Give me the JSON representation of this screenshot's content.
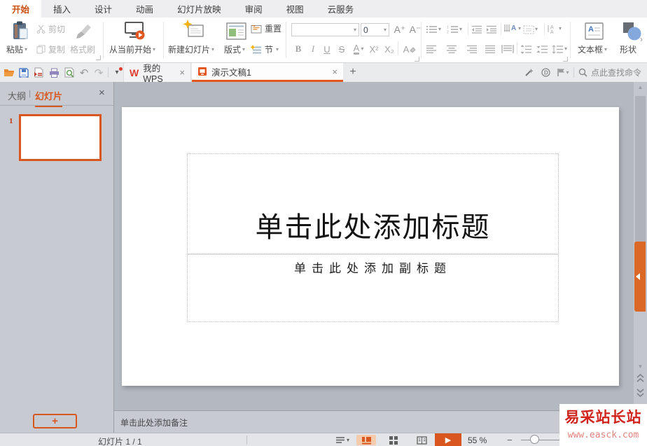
{
  "colors": {
    "accent": "#d9571e",
    "menu_active_text": "#c9500f",
    "watermark_red": "#d0241c",
    "highlight_bg": "#f5cbae"
  },
  "icons": {
    "dropdown_caret": "▾",
    "close": "×",
    "add_tab": "+",
    "chevron_more": "›",
    "play": "▶",
    "minus": "−",
    "undo": "↶",
    "redo": "↷",
    "up_arrow": "▲",
    "down_arrow": "▼",
    "paste-icon": "clipboard",
    "cut-icon": "scissors",
    "copy-icon": "two-pages",
    "format-painter-icon": "brush",
    "play-from-current-icon": "screen-with-play",
    "new-slide-icon": "slide-with-sparkle",
    "layout-icon": "slide-layout",
    "reset-icon": "slide-refresh",
    "section-icon": "rows-with-sparkle",
    "textbox-icon": "box-with-A",
    "shapes-icon": "square-and-circle",
    "open-icon": "folder",
    "save-icon": "floppy",
    "export-pdf-icon": "page-pdf",
    "print-icon": "printer",
    "preview-icon": "page-magnifier",
    "beautify-icon": "magic-wand",
    "docer-icon": "circled-d",
    "taskpane-icon": "flag",
    "search-icon": "magnifier"
  },
  "menu": {
    "tabs": [
      {
        "label": "开始",
        "active": true
      },
      {
        "label": "插入"
      },
      {
        "label": "设计"
      },
      {
        "label": "动画"
      },
      {
        "label": "幻灯片放映"
      },
      {
        "label": "审阅"
      },
      {
        "label": "视图"
      },
      {
        "label": "云服务"
      }
    ]
  },
  "ribbon": {
    "paste": {
      "label": "粘贴"
    },
    "cut": {
      "label": "剪切"
    },
    "copy": {
      "label": "复制"
    },
    "format_painter": {
      "label": "格式刷"
    },
    "start_from_current": {
      "label": "从当前开始"
    },
    "new_slide": {
      "label": "新建幻灯片"
    },
    "layout": {
      "label": "版式"
    },
    "reset": {
      "label": "重置"
    },
    "section": {
      "label": "节"
    },
    "font": {
      "name_value": "",
      "size_value": "0",
      "grow": "A⁺",
      "shrink": "A⁻",
      "bold": "B",
      "italic": "I",
      "underline": "U",
      "strikethrough": "S",
      "color": "A",
      "superscript": "X²",
      "subscript": "X₂",
      "clear": "A"
    },
    "textbox": {
      "label": "文本框"
    },
    "shapes": {
      "label": "形状"
    }
  },
  "tabbar": {
    "documents": [
      {
        "label": "我的WPS",
        "active": false
      },
      {
        "label": "演示文稿1",
        "active": true
      }
    ],
    "wps_logo": "W",
    "find_command": "点此查找命令"
  },
  "panel": {
    "outline": "大纲",
    "divider": "|",
    "slides": "幻灯片",
    "slide_number": "1",
    "add_slide_label": "+"
  },
  "slide": {
    "title": "单击此处添加标题",
    "subtitle": "单击此处添加副标题"
  },
  "notes": {
    "placeholder": "单击此处添加备注"
  },
  "statusbar": {
    "slide_counter": "幻灯片 1 / 1",
    "zoom": "55 %"
  },
  "watermark": {
    "name": "易采站长站",
    "site": "www.easck.com"
  }
}
